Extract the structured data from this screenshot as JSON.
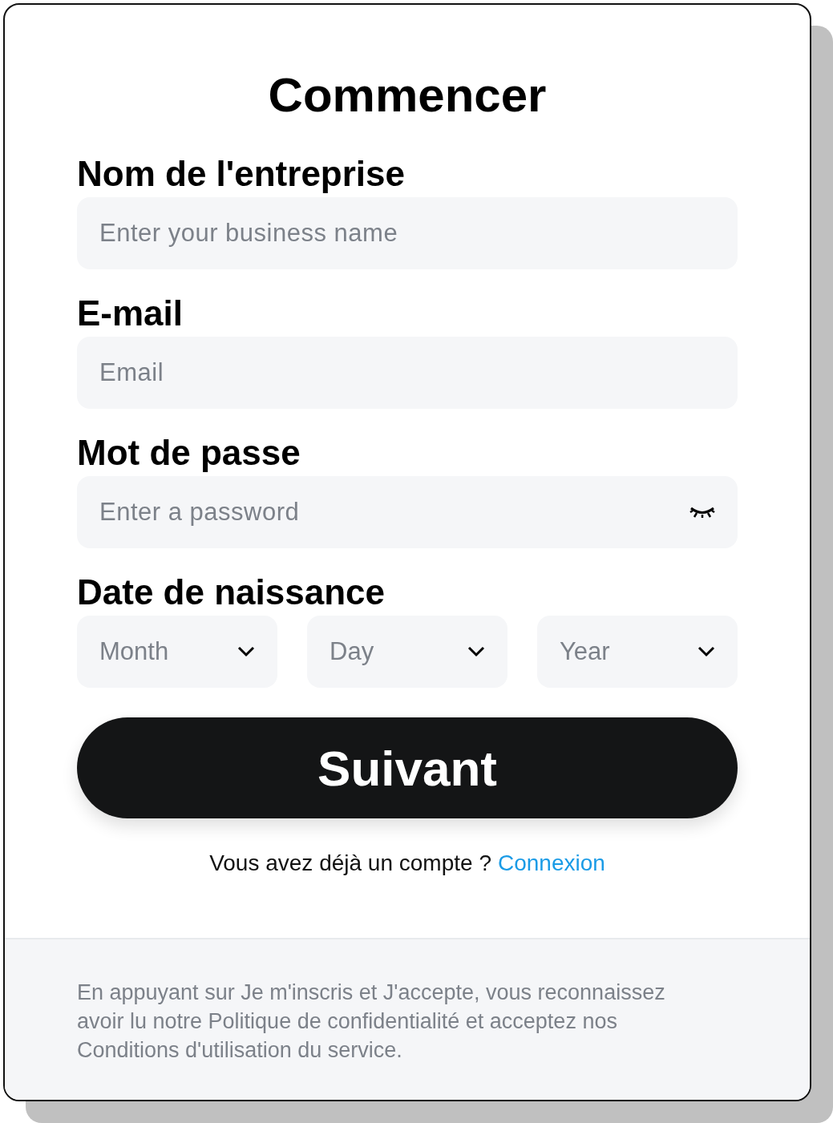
{
  "title": "Commencer",
  "fields": [
    {
      "kind": "text",
      "label": "Nom de l'entreprise",
      "placeholder": "Enter your business name"
    },
    {
      "kind": "text",
      "label": "E-mail",
      "placeholder": "Email"
    },
    {
      "kind": "password",
      "label": "Mot de passe",
      "placeholder": "Enter a password"
    }
  ],
  "birth_date": {
    "label": "Date de naissance",
    "selects": [
      {
        "placeholder": "Month"
      },
      {
        "placeholder": "Day"
      },
      {
        "placeholder": "Year"
      }
    ]
  },
  "submit": "Suivant",
  "login": {
    "text": "Vous avez déjà un compte ?",
    "link": "Connexion"
  },
  "footer": "En appuyant sur Je m'inscris et J'accepte, vous reconnaissez avoir lu notre Politique de confidentialité et acceptez nos Conditions d'utilisation du service."
}
